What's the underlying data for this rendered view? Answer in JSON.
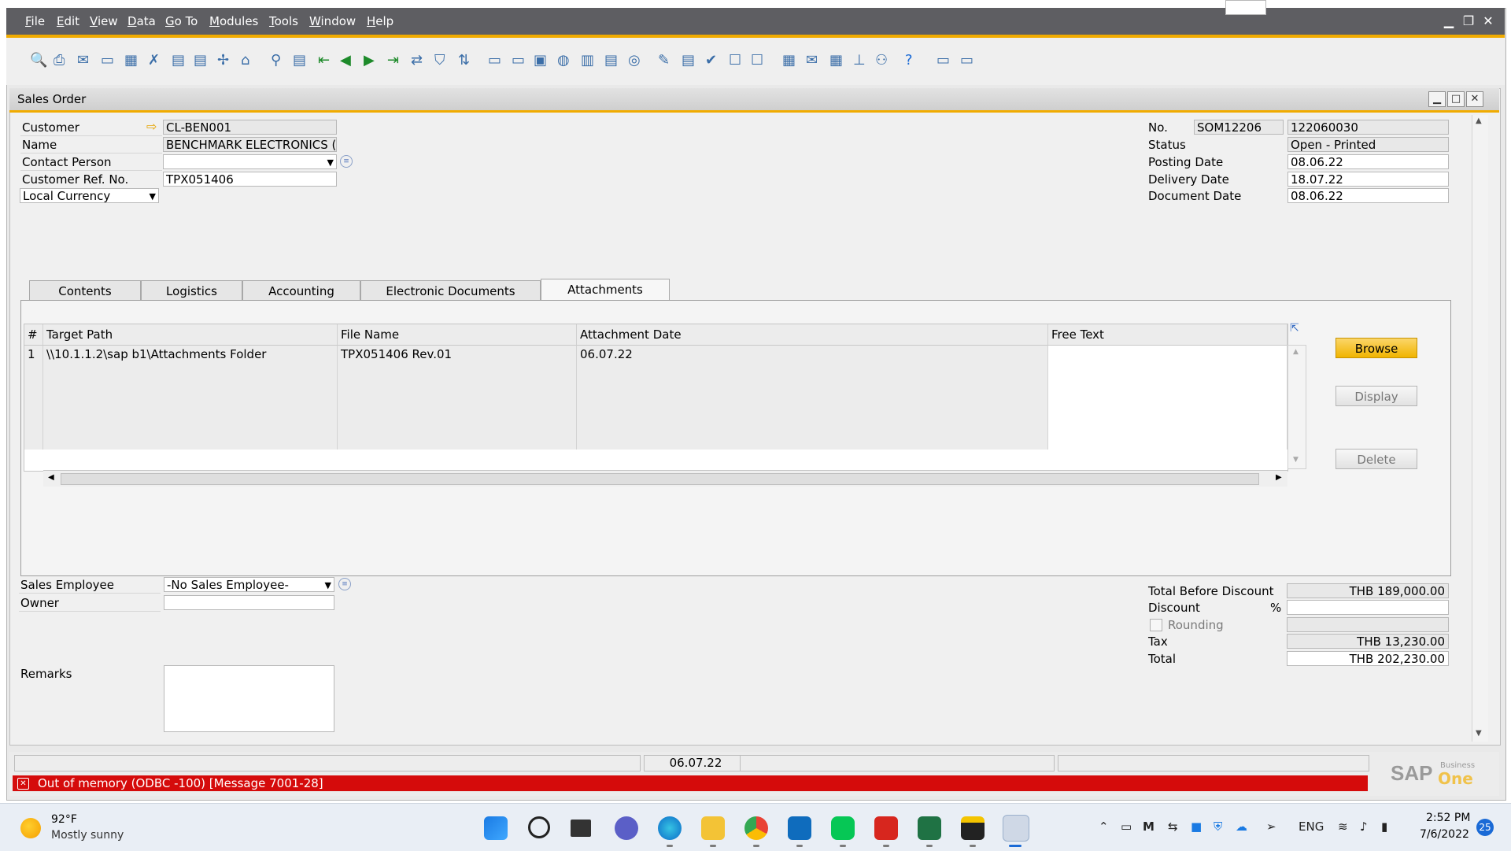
{
  "menu": [
    "File",
    "Edit",
    "View",
    "Data",
    "Go To",
    "Modules",
    "Tools",
    "Window",
    "Help"
  ],
  "menu_underline": [
    "F",
    "E",
    "V",
    "D",
    "G",
    "M",
    "T",
    "W",
    "H"
  ],
  "window_title": "Sales Order",
  "header_left": {
    "customer_label": "Customer",
    "customer_value": "CL-BEN001",
    "name_label": "Name",
    "name_value": "BENCHMARK ELECTRONICS (TH",
    "contact_label": "Contact Person",
    "contact_value": "",
    "ref_label": "Customer Ref. No.",
    "ref_value": "TPX051406",
    "currency_value": "Local Currency"
  },
  "header_right": {
    "no_label": "No.",
    "series_value": "SOM12206",
    "doc_number": "122060030",
    "status_label": "Status",
    "status_value": "Open - Printed",
    "posting_label": "Posting Date",
    "posting_value": "08.06.22",
    "delivery_label": "Delivery Date",
    "delivery_value": "18.07.22",
    "document_label": "Document Date",
    "document_value": "08.06.22"
  },
  "tabs": [
    "Contents",
    "Logistics",
    "Accounting",
    "Electronic Documents",
    "Attachments"
  ],
  "active_tab": "Attachments",
  "attachments": {
    "columns": [
      "#",
      "Target Path",
      "File Name",
      "Attachment Date",
      "Free Text"
    ],
    "rows": [
      {
        "num": "1",
        "path": "\\\\10.1.1.2\\sap b1\\Attachments Folder",
        "file": "TPX051406 Rev.01",
        "date": "06.07.22",
        "free": ""
      }
    ],
    "empty_rows": 5
  },
  "buttons": {
    "browse": "Browse",
    "display": "Display",
    "delete": "Delete"
  },
  "footer_left": {
    "sales_employee_label": "Sales Employee",
    "sales_employee_value": "-No Sales Employee-",
    "owner_label": "Owner",
    "owner_value": "",
    "remarks_label": "Remarks",
    "remarks_value": ""
  },
  "totals": {
    "before_discount_label": "Total Before Discount",
    "before_discount_value": "THB 189,000.00",
    "discount_label": "Discount",
    "discount_pct": "",
    "discount_pct_symbol": "%",
    "discount_value": "",
    "rounding_label": "Rounding",
    "rounding_checked": false,
    "tax_label": "Tax",
    "tax_value": "THB 13,230.00",
    "total_label": "Total",
    "total_value": "THB 202,230.00"
  },
  "status_bar": {
    "date": "06.07.22",
    "error": "Out of memory (ODBC -100)  [Message 7001-28]",
    "brand": "SAP",
    "brand_sub1": "Business",
    "brand_sub2": "One"
  },
  "taskbar": {
    "weather_temp": "92°F",
    "weather_desc": "Mostly sunny",
    "language": "ENG",
    "time": "2:52 PM",
    "date": "7/6/2022",
    "notifications": "25"
  },
  "colors": {
    "accent": "#f0ab00",
    "error": "#d50b0b",
    "menubar": "#5e5e62"
  }
}
